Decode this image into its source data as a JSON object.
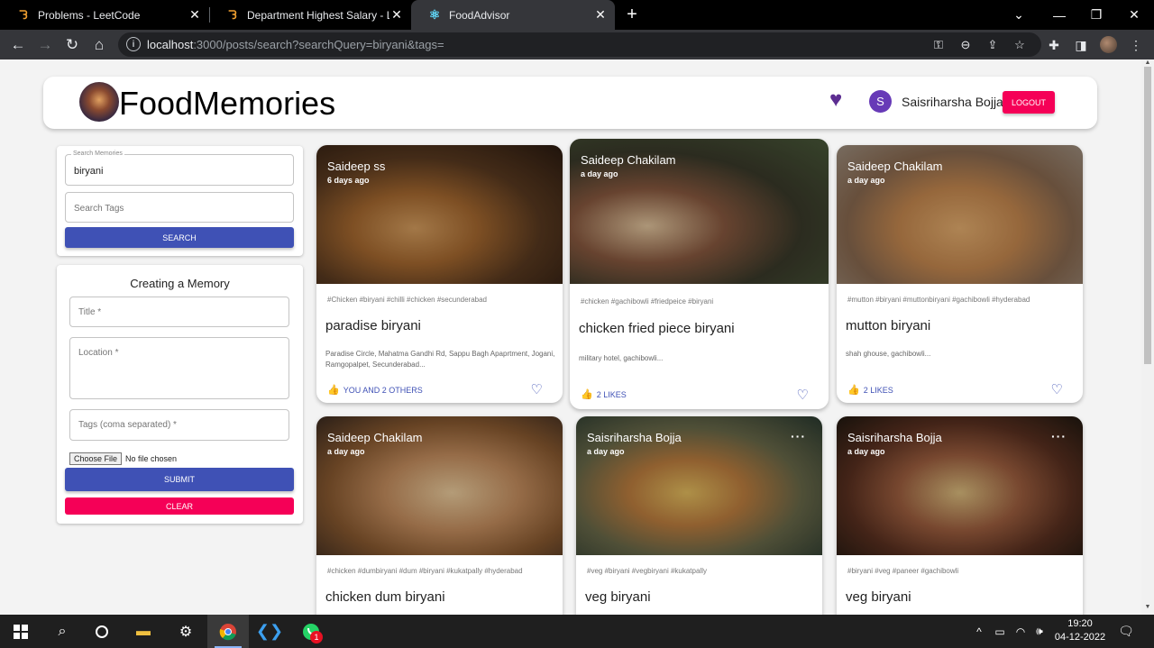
{
  "browser": {
    "tabs": [
      {
        "label": "Problems - LeetCode",
        "icon": "leetcode-icon"
      },
      {
        "label": "Department Highest Salary - LeetC",
        "icon": "leetcode-icon"
      },
      {
        "label": "FoodAdvisor",
        "icon": "react-icon"
      }
    ],
    "url_host": "localhost",
    "url_rest": ":3000/posts/search?searchQuery=biryani&tags="
  },
  "app": {
    "brand": "FoodMemories",
    "avatar_letter": "S",
    "username": "Saisriharsha Bojja",
    "logout_label": "LOGOUT"
  },
  "search": {
    "legend": "Search Memories",
    "query_value": "biryani",
    "tags_placeholder": "Search Tags",
    "button_label": "SEARCH"
  },
  "form": {
    "heading": "Creating a Memory",
    "title_placeholder": "Title *",
    "location_placeholder": "Location *",
    "tags_placeholder": "Tags (coma separated) *",
    "choose_file_label": "Choose File",
    "file_status": "No file chosen",
    "submit_label": "SUBMIT",
    "clear_label": "CLEAR"
  },
  "posts": [
    {
      "author": "Saideep ss",
      "time": "6 days ago",
      "tags": "#Chicken #biryani #chilli #chicken #secunderabad",
      "title": "paradise biryani",
      "message": "Paradise Circle, Mahatma Gandhi Rd, Sappu Bagh Apaprtment, Jogani, Ramgopalpet, Secunderabad...",
      "likes": "YOU AND 2 OTHERS"
    },
    {
      "author": "Saideep Chakilam",
      "time": "a day ago",
      "tags": "#chicken #gachibowli #friedpeice #biryani",
      "title": "chicken fried piece biryani",
      "message": "military hotel, gachibowli...",
      "likes": "2 LIKES"
    },
    {
      "author": "Saideep Chakilam",
      "time": "a day ago",
      "tags": "#mutton #biryani #muttonbiryani #gachibowli #hyderabad",
      "title": "mutton biryani",
      "message": "shah ghouse, gachibowli...",
      "likes": "2 LIKES"
    },
    {
      "author": "Saideep Chakilam",
      "time": "a day ago",
      "tags": "#chicken #dumbiryani #dum #biryani #kukatpally #hyderabad",
      "title": "chicken dum biryani"
    },
    {
      "author": "Saisriharsha Bojja",
      "time": "a day ago",
      "tags": "#veg #biryani #vegbiryani #kukatpally",
      "title": "veg biryani",
      "more": "···"
    },
    {
      "author": "Saisriharsha Bojja",
      "time": "a day ago",
      "tags": "#biryani #veg #paneer #gachibowli",
      "title": "veg biryani",
      "more": "···"
    }
  ],
  "taskbar": {
    "time": "19:20",
    "date": "04-12-2022",
    "whatsapp_badge": "1"
  }
}
